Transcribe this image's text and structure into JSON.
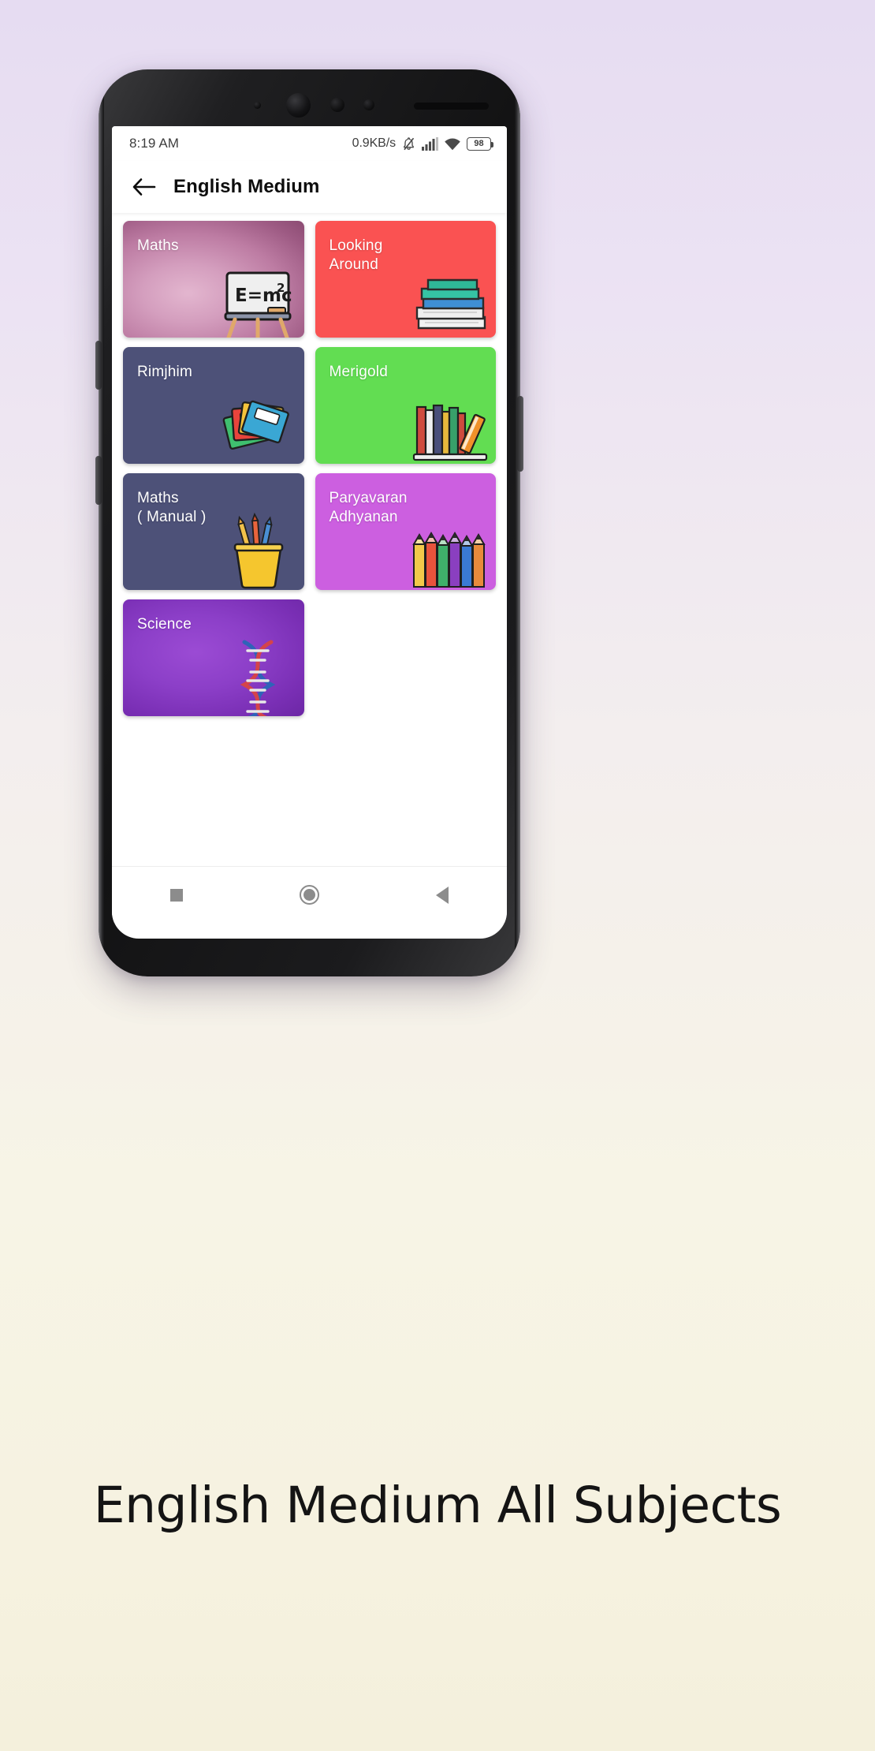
{
  "page": {
    "caption": "English Medium All\nSubjects",
    "background_gradient_top": "#e6dcf2",
    "background_gradient_bottom": "#f4f0dc"
  },
  "statusbar": {
    "time": "8:19 AM",
    "network_speed": "0.9KB/s",
    "icons": {
      "notifications_muted": "bell-muted-icon",
      "signal": "signal-bars-icon",
      "wifi": "wifi-icon",
      "battery": "battery-icon"
    },
    "battery_level": "98"
  },
  "appbar": {
    "back_icon": "back-arrow-icon",
    "title": "English Medium"
  },
  "grid": {
    "cards": [
      {
        "label": "Maths",
        "art": "blackboard-emc2-icon",
        "bg_class": "bg-maths",
        "color": "#bd7ca3"
      },
      {
        "label": "Looking\nAround",
        "art": "stacked-books-icon",
        "bg_class": "bg-looking",
        "color": "#fa5252"
      },
      {
        "label": "Rimjhim",
        "art": "notebooks-icon",
        "bg_class": "bg-rimjhim",
        "color": "#4d5178"
      },
      {
        "label": "Merigold",
        "art": "bookshelf-icon",
        "bg_class": "bg-merigold",
        "color": "#62dd52"
      },
      {
        "label": "Maths\n( Manual )",
        "art": "pencil-cup-icon",
        "bg_class": "bg-mathsman",
        "color": "#4d5178"
      },
      {
        "label": "Paryavaran\nAdhyanan",
        "art": "colored-pencils-icon",
        "bg_class": "bg-paryavaran",
        "color": "#cc5fe0"
      },
      {
        "label": "Science",
        "art": "dna-helix-icon",
        "bg_class": "bg-science",
        "color": "#8c3fc8"
      }
    ]
  },
  "navbar": {
    "recents": "recents-square-icon",
    "home": "home-circle-icon",
    "back": "back-triangle-icon"
  }
}
